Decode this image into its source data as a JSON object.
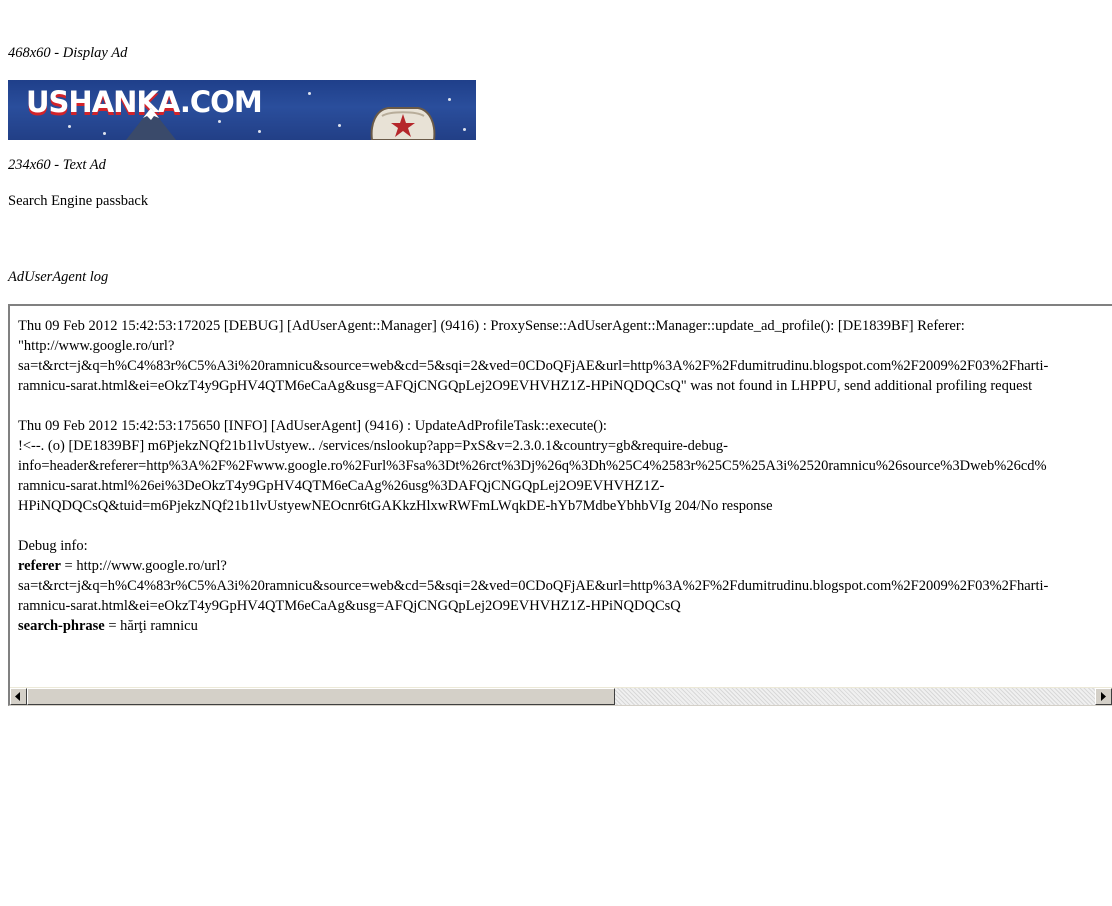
{
  "ads": {
    "display_heading": "468x60 - Display Ad",
    "banner_logo_part1": "USHANKA",
    "banner_logo_part2": ".COM",
    "text_heading": "234x60 - Text Ad",
    "passback_text": "Search Engine passback"
  },
  "log": {
    "heading": "AdUserAgent log",
    "entry1": [
      "Thu 09 Feb 2012 15:42:53:172025 [DEBUG] [AdUserAgent::Manager] (9416) : ProxySense::AdUserAgent::Manager::update_ad_profile(): [DE1839BF] Referer:",
      "\"http://www.google.ro/url?",
      "sa=t&rct=j&q=h%C4%83r%C5%A3i%20ramnicu&source=web&cd=5&sqi=2&ved=0CDoQFjAE&url=http%3A%2F%2Fdumitrudinu.blogspot.com%2F2009%2F03%2Fharti-",
      "ramnicu-sarat.html&ei=eOkzT4y9GpHV4QTM6eCaAg&usg=AFQjCNGQpLej2O9EVHVHZ1Z-HPiNQDQCsQ\" was not found in LHPPU, send additional profiling request"
    ],
    "entry2": [
      "Thu 09 Feb 2012 15:42:53:175650 [INFO] [AdUserAgent] (9416) : UpdateAdProfileTask::execute():",
      "!<--. (o) [DE1839BF] m6PjekzNQf21b1lvUstyew.. /services/nslookup?app=PxS&v=2.3.0.1&country=gb&require-debug-",
      "info=header&referer=http%3A%2F%2Fwww.google.ro%2Furl%3Fsa%3Dt%26rct%3Dj%26q%3Dh%25C4%2583r%25C5%25A3i%2520ramnicu%26source%3Dweb%26cd%",
      "ramnicu-sarat.html%26ei%3DeOkzT4y9GpHV4QTM6eCaAg%26usg%3DAFQjCNGQpLej2O9EVHVHZ1Z-",
      "HPiNQDQCsQ&tuid=m6PjekzNQf21b1lvUstyewNEOcnr6tGAKkzHlxwRWFmLWqkDE-hYb7MdbeYbhbVIg 204/No response"
    ],
    "debug_info_label": "Debug info:",
    "referer_key": "referer",
    "referer_value_line1": " = http://www.google.ro/url?",
    "referer_value_line2": "sa=t&rct=j&q=h%C4%83r%C5%A3i%20ramnicu&source=web&cd=5&sqi=2&ved=0CDoQFjAE&url=http%3A%2F%2Fdumitrudinu.blogspot.com%2F2009%2F03%2Fharti-",
    "referer_value_line3": "ramnicu-sarat.html&ei=eOkzT4y9GpHV4QTM6eCaAg&usg=AFQjCNGQpLej2O9EVHVHZ1Z-HPiNQDQCsQ",
    "search_phrase_key": "search-phrase",
    "search_phrase_value": " = hărţi ramnicu"
  },
  "scrollbar": {
    "position": 0
  }
}
